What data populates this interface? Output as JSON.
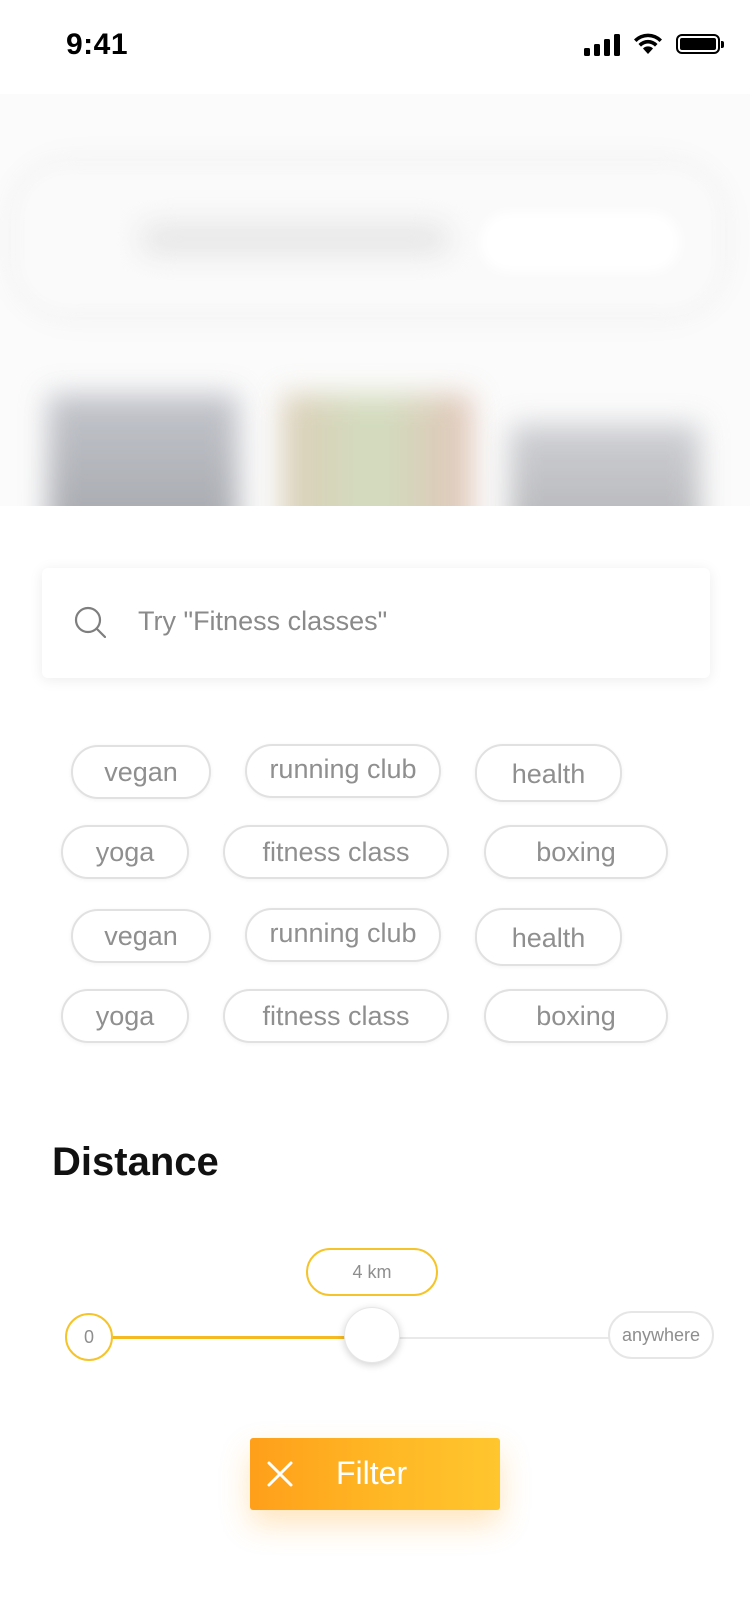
{
  "status_bar": {
    "time": "9:41",
    "icons": [
      "cellular-signal-icon",
      "wifi-icon",
      "battery-icon"
    ]
  },
  "search": {
    "placeholder": "Try \"Fitness classes\"",
    "icon": "search-icon"
  },
  "tags": [
    "vegan",
    "running club",
    "health",
    "yoga",
    "fitness class",
    "boxing",
    "vegan",
    "running club",
    "health",
    "yoga",
    "fitness class",
    "boxing"
  ],
  "distance": {
    "title": "Distance",
    "min_label": "0",
    "value_label": "4 km",
    "max_label": "anywhere",
    "value_fraction": 0.5
  },
  "filter_button": {
    "label": "Filter",
    "icon": "close-icon"
  },
  "colors": {
    "accent": "#f5b921",
    "button_gradient_start": "#ff9f1a",
    "button_gradient_end": "#ffc62e",
    "tag_text": "#8f8f8f"
  }
}
